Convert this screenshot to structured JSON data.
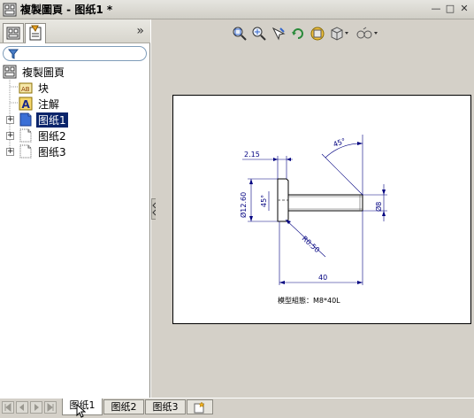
{
  "window": {
    "title": "複製圖頁 - 图纸1 *",
    "min_symbol": "—",
    "max_symbol": "□",
    "close_symbol": "✕"
  },
  "left_pane": {
    "collapse_symbol": "»",
    "filter_placeholder": "",
    "tree": {
      "root_label": "複製圖頁",
      "items": [
        {
          "label": "块",
          "icon": "block-icon"
        },
        {
          "label": "注解",
          "icon": "annotation-icon"
        },
        {
          "label": "图纸1",
          "icon": "sheet-icon",
          "selected": true,
          "expander": "+"
        },
        {
          "label": "图纸2",
          "icon": "sheet-icon",
          "expander": "+"
        },
        {
          "label": "图纸3",
          "icon": "sheet-icon",
          "expander": "+"
        }
      ]
    }
  },
  "drawing": {
    "dim_chamfer_len": "2.15",
    "dim_head_dia": "Ø12.60",
    "dim_head_angle": "45°",
    "dim_tip_angle": "45°",
    "dim_radius": "R0.50",
    "dim_length": "40",
    "dim_shank_dia": "Ø8",
    "caption": "模型組態：M8*40L"
  },
  "sheet_tabs": {
    "tabs": [
      "图纸1",
      "图纸2",
      "图纸3"
    ],
    "active": "图纸1"
  },
  "colors": {
    "selection": "#0a246a",
    "dimension": "#000080",
    "sheet_icon": "#3b6fd6"
  }
}
